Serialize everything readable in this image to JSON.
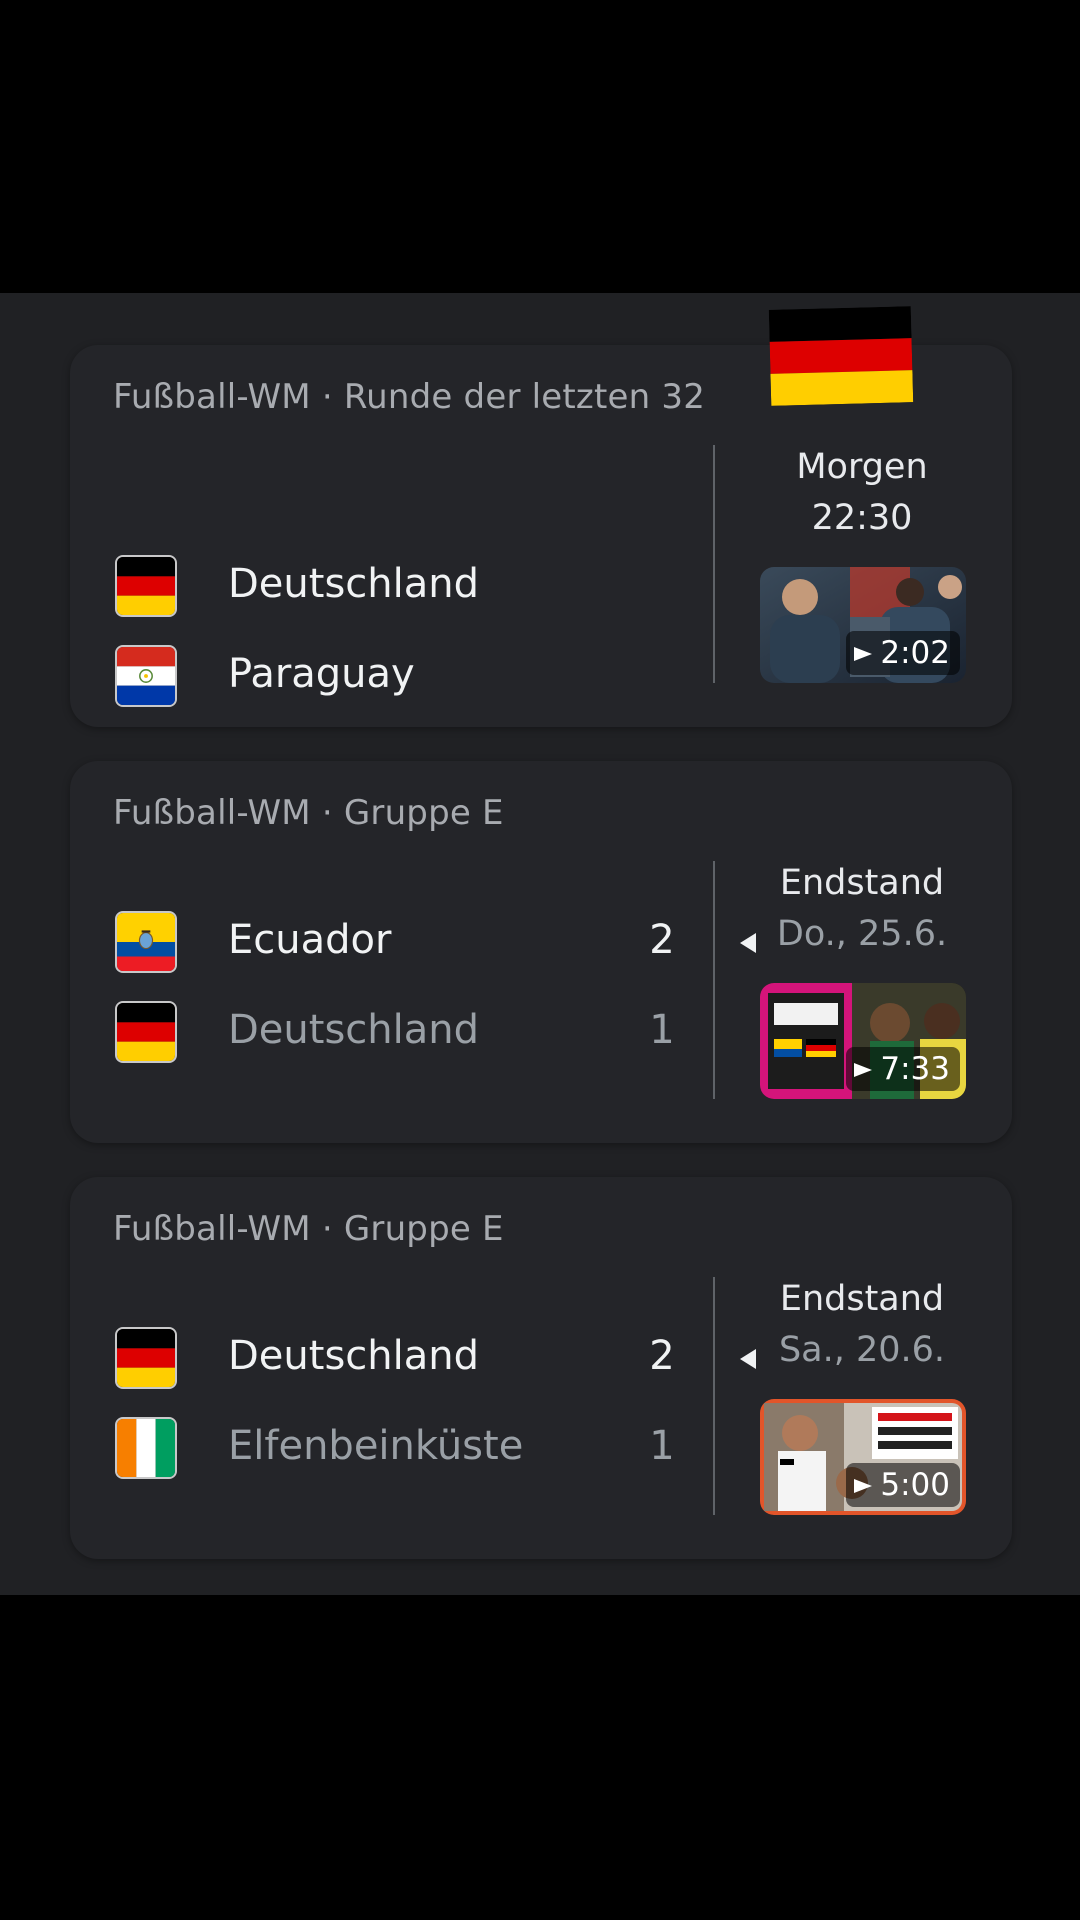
{
  "matches": [
    {
      "competition": "Fußball-WM · Runde der letzten 32",
      "status_line1": "Morgen",
      "status_line2": "22:30",
      "teams": [
        {
          "name": "Deutschland",
          "flag": "germany-flag",
          "score": null,
          "winner": false
        },
        {
          "name": "Paraguay",
          "flag": "paraguay-flag",
          "score": null,
          "winner": false
        }
      ],
      "video_duration": "2:02"
    },
    {
      "competition": "Fußball-WM · Gruppe E",
      "status_line1": "Endstand",
      "status_line2": "Do., 25.6.",
      "teams": [
        {
          "name": "Ecuador",
          "flag": "ecuador-flag",
          "score": "2",
          "winner": true
        },
        {
          "name": "Deutschland",
          "flag": "germany-flag",
          "score": "1",
          "winner": false
        }
      ],
      "video_duration": "7:33"
    },
    {
      "competition": "Fußball-WM · Gruppe E",
      "status_line1": "Endstand",
      "status_line2": "Sa., 20.6.",
      "teams": [
        {
          "name": "Deutschland",
          "flag": "germany-flag",
          "score": "2",
          "winner": true
        },
        {
          "name": "Elfenbeinküste",
          "flag": "ivory-coast-flag",
          "score": "1",
          "winner": false
        }
      ],
      "video_duration": "5:00"
    }
  ],
  "colors": {
    "background": "#000000",
    "panel": "#202124",
    "card": "#242529",
    "text_primary": "#f1f3f4",
    "text_secondary": "#9aa0a6"
  }
}
